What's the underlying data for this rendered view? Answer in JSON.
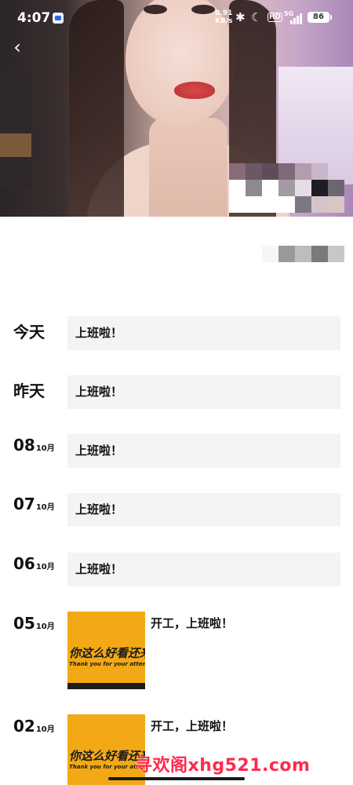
{
  "status_bar": {
    "time": "4:07",
    "net_speed_value": "0.91",
    "net_speed_unit": "KB/s",
    "hd_label": "HD",
    "signal_label": "5G",
    "battery": "86"
  },
  "icons": {
    "back": "chevron-left-icon",
    "bluetooth": "bluetooth-icon",
    "moon": "moon-icon"
  },
  "timeline": [
    {
      "date_label": "今天",
      "text": "上班啦！"
    },
    {
      "date_label": "昨天",
      "text": "上班啦！"
    },
    {
      "day": "08",
      "month": "10月",
      "text": "上班啦！"
    },
    {
      "day": "07",
      "month": "10月",
      "text": "上班啦！"
    },
    {
      "day": "06",
      "month": "10月",
      "text": "上班啦！"
    },
    {
      "day": "05",
      "month": "10月",
      "caption": "开工，上班啦！",
      "image_text_cn": "你这么好看还来",
      "image_text_en": "Thank you for your atten"
    },
    {
      "day": "02",
      "month": "10月",
      "caption": "开工，上班啦！",
      "image_text_cn": "你这么好看还来",
      "image_text_en": "Thank you for your atten"
    }
  ],
  "watermark": "寻欢阁xhg521.com",
  "colors": {
    "card_bg": "#f4f4f4",
    "thumb_bg": "#f3a915",
    "watermark": "#ff2a4e"
  }
}
